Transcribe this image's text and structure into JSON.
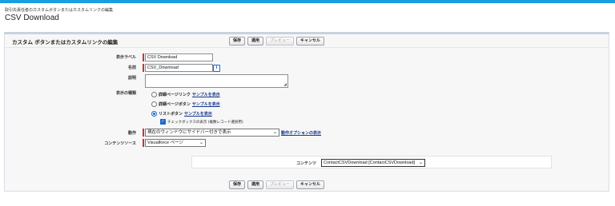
{
  "breadcrumb": "取引先責任者のカスタムボタンまたはカスタムリンクの編集",
  "page_title": "CSV Download",
  "panel": {
    "title": "カスタム ボタンまたはカスタムリンクの編集"
  },
  "buttons": {
    "save": "保存",
    "quick_save": "適用",
    "preview": "プレビュー",
    "cancel": "キャンセル"
  },
  "form": {
    "label_field": {
      "label": "表示ラベル",
      "value": "CSV Download"
    },
    "name_field": {
      "label": "名前",
      "value": "CSV_Download",
      "info_icon": "info-icon"
    },
    "description_field": {
      "label": "説明",
      "value": ""
    },
    "display_type": {
      "label": "表示の種類",
      "options": [
        {
          "label": "詳細ページリンク",
          "link": "サンプルを表示",
          "checked": false
        },
        {
          "label": "詳細ページボタン",
          "link": "サンプルを表示",
          "checked": false
        },
        {
          "label": "リストボタン",
          "link": "サンプルを表示",
          "checked": true
        }
      ],
      "checkbox": {
        "label": "チェックボックスの表示 (複数レコード選択用)",
        "checked": true
      }
    },
    "behavior": {
      "label": "動作",
      "value": "現在のウィンドウにサイドバー付きで表示",
      "link": "動作オプションの表示"
    },
    "content_source": {
      "label": "コンテンツソース",
      "value": "Visualforce ページ"
    },
    "content": {
      "label": "コンテンツ",
      "value": "ContactCSVDownload [ContactCSVDownload]"
    }
  },
  "colors": {
    "accent_bar": "#1b9ee0",
    "required": "#c23934",
    "link": "#15398c"
  }
}
